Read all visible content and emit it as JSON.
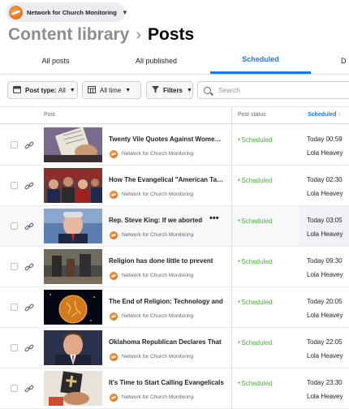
{
  "page_selector": {
    "name": "Network for Church Monitoring"
  },
  "breadcrumb": {
    "parent": "Content library",
    "separator": "›",
    "current": "Posts"
  },
  "tabs": [
    {
      "label": "All posts"
    },
    {
      "label": "All published"
    },
    {
      "label": "Scheduled",
      "active": true
    },
    {
      "label": "D"
    }
  ],
  "toolbar": {
    "post_type_label": "Post type:",
    "post_type_value": "All",
    "time_label": "All time",
    "filters_label": "Filters",
    "search_placeholder": "Search"
  },
  "table": {
    "headers": {
      "post": "Post",
      "status": "Post status",
      "scheduled": "Scheduled ↑"
    },
    "rows": [
      {
        "title": "Twenty Vile Quotes Against Women in the Bible",
        "page": "Network for Church Monitoring",
        "status": "Scheduled",
        "when": "Today 00:59",
        "who": "Lola Heavey"
      },
      {
        "title": "How The Evangelical \"American Taliban\"",
        "page": "Network for Church Monitoring",
        "status": "Scheduled",
        "when": "Today 02:30",
        "who": "Lola Heavey"
      },
      {
        "title": "Rep. Steve King: If we aborted",
        "page": "Network for Church Monitoring",
        "status": "Scheduled",
        "when": "Today 03:05",
        "who": "Lola Heavey"
      },
      {
        "title": "Religion has done little to prevent",
        "page": "Network for Church Monitoring",
        "status": "Scheduled",
        "when": "Today 09:30",
        "who": "Lola Heavey"
      },
      {
        "title": "The End of Religion: Technology and",
        "page": "Network for Church Monitoring",
        "status": "Scheduled",
        "when": "Today 20:05",
        "who": "Lola Heavey"
      },
      {
        "title": "Oklahoma Republican Declares That",
        "page": "Network for Church Monitoring",
        "status": "Scheduled",
        "when": "Today 22:05",
        "who": "Lola Heavey"
      },
      {
        "title": "It's Time to Start Calling Evangelicals",
        "page": "Network for Church Monitoring",
        "status": "Scheduled",
        "when": "Today 23:30",
        "who": "Lola Heavey"
      }
    ]
  },
  "colors": {
    "accent": "#1877f2",
    "scheduled": "#42b72a"
  }
}
